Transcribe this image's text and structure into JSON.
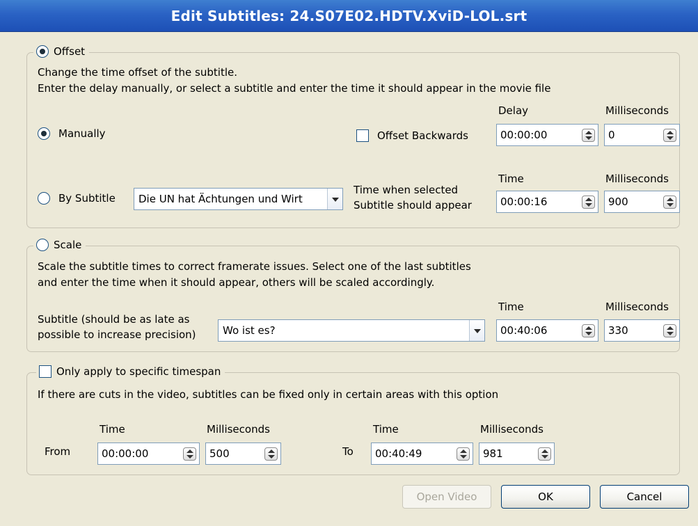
{
  "window": {
    "title": "Edit Subtitles: 24.S07E02.HDTV.XviD-LOL.srt"
  },
  "offset": {
    "legend": "Offset",
    "selected": true,
    "desc1": "Change the time offset of the subtitle.",
    "desc2": "Enter the delay manually, or select a subtitle and enter the time it should appear in the movie file",
    "manually": {
      "label": "Manually",
      "selected": true,
      "offset_backwards_label": "Offset Backwards",
      "delay_label": "Delay",
      "delay_value": "00:00:00",
      "ms_label": "Milliseconds",
      "ms_value": "0"
    },
    "by_subtitle": {
      "label": "By Subtitle",
      "selected": false,
      "subtitle_value": "Die UN hat Ächtungen und Wirt",
      "time_when_label1": "Time when selected",
      "time_when_label2": "Subtitle should appear",
      "time_label": "Time",
      "time_value": "00:00:16",
      "ms_label": "Milliseconds",
      "ms_value": "900"
    }
  },
  "scale": {
    "legend": "Scale",
    "selected": false,
    "desc1": "Scale the subtitle times to correct framerate issues. Select one of the last subtitles",
    "desc2": "and enter the time when it should appear, others will be scaled accordingly.",
    "subtitle_label1": "Subtitle (should be as late as",
    "subtitle_label2": "possible to increase precision)",
    "subtitle_value": "Wo ist es?",
    "time_label": "Time",
    "time_value": "00:40:06",
    "ms_label": "Milliseconds",
    "ms_value": "330"
  },
  "timespan": {
    "legend": "Only apply to specific timespan",
    "checked": false,
    "desc": "If there are cuts in the video, subtitles can be fixed only in certain areas with this option",
    "from_label": "From",
    "from_time_label": "Time",
    "from_time_value": "00:00:00",
    "from_ms_label": "Milliseconds",
    "from_ms_value": "500",
    "to_label": "To",
    "to_time_label": "Time",
    "to_time_value": "00:40:49",
    "to_ms_label": "Milliseconds",
    "to_ms_value": "981"
  },
  "buttons": {
    "open_video": "Open Video",
    "ok": "OK",
    "cancel": "Cancel"
  }
}
